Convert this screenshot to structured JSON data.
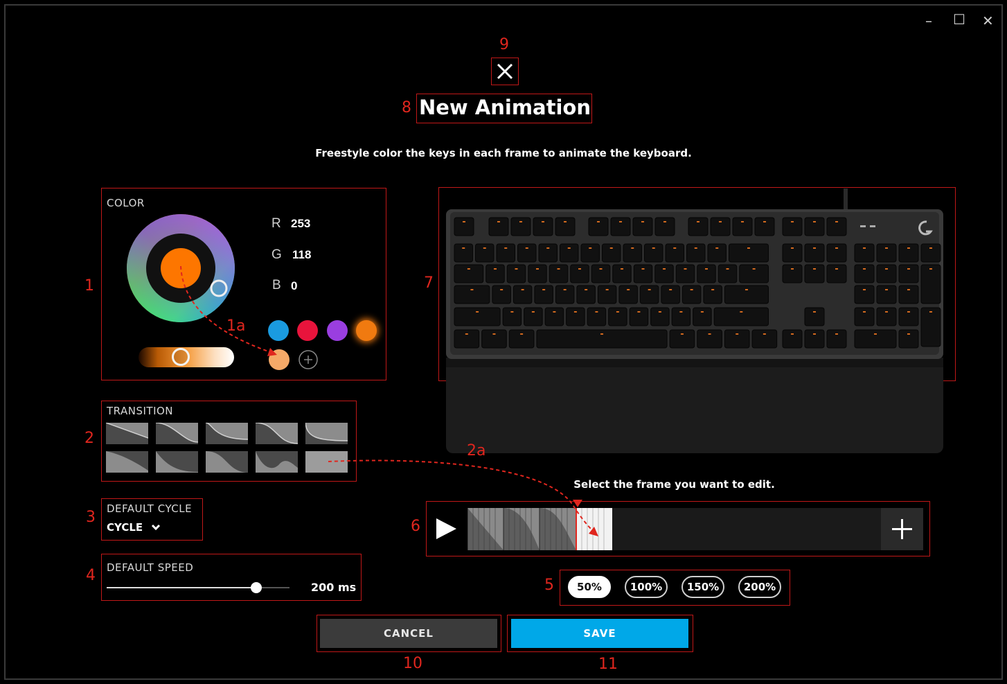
{
  "dialog": {
    "title": "New Animation",
    "subtitle": "Freestyle color the keys in each frame to animate the keyboard."
  },
  "window_controls": {
    "minimize": "–",
    "maximize": "☐",
    "close": "✕"
  },
  "color": {
    "label": "COLOR",
    "r_label": "R",
    "r_value": "253",
    "g_label": "G",
    "g_value": "118",
    "b_label": "B",
    "b_value": "0",
    "current": "#fd7600",
    "presets": [
      "#1a9be0",
      "#e8143c",
      "#9a3ee0",
      "#f07a10",
      "#f5a968"
    ]
  },
  "transition": {
    "label": "TRANSITION"
  },
  "default_cycle": {
    "label": "DEFAULT CYCLE",
    "value": "CYCLE"
  },
  "default_speed": {
    "label": "DEFAULT SPEED",
    "value": "200 ms",
    "level": 0.82
  },
  "timeline": {
    "hint": "Select the frame you want to edit."
  },
  "zoom": {
    "options": [
      "50%",
      "100%",
      "150%",
      "200%"
    ],
    "selected": "50%"
  },
  "actions": {
    "cancel": "CANCEL",
    "save": "SAVE"
  },
  "annotations": {
    "n1": "1",
    "n1a": "1a",
    "n2": "2",
    "n2a": "2a",
    "n3": "3",
    "n4": "4",
    "n5": "5",
    "n6": "6",
    "n7": "7",
    "n8": "8",
    "n9": "9",
    "n10": "10",
    "n11": "11"
  },
  "accent_colors": {
    "annotation": "#c01818",
    "save": "#00a8e8"
  }
}
